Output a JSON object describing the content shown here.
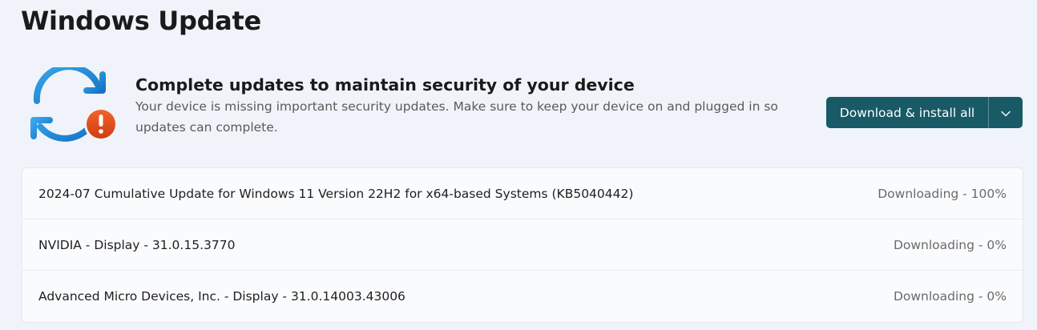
{
  "page": {
    "title": "Windows Update"
  },
  "status": {
    "icon": "sync-warning-icon",
    "heading": "Complete updates to maintain security of your device",
    "description": "Your device is missing important security updates. Make sure to keep your device on and plugged in so updates can complete."
  },
  "actions": {
    "install_all_label": "Download & install all",
    "dropdown_icon": "chevron-down-icon",
    "accent_color": "#185a65"
  },
  "updates": [
    {
      "name": "2024-07 Cumulative Update for Windows 11 Version 22H2 for x64-based Systems (KB5040442)",
      "status": "Downloading - 100%"
    },
    {
      "name": "NVIDIA - Display - 31.0.15.3770",
      "status": "Downloading - 0%"
    },
    {
      "name": "Advanced Micro Devices, Inc. - Display - 31.0.14003.43006",
      "status": "Downloading - 0%"
    }
  ]
}
